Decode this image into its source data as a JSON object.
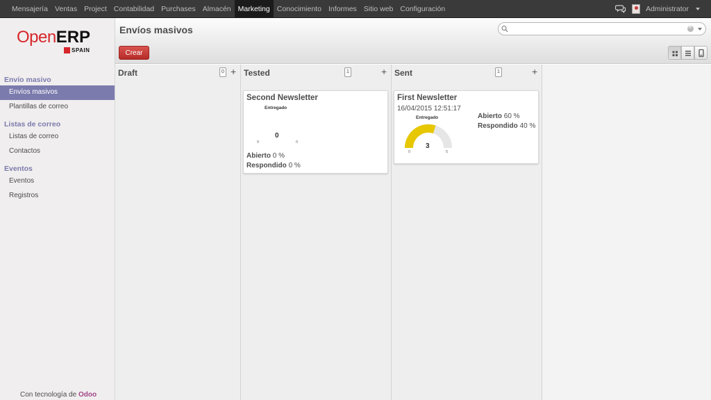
{
  "topmenu": {
    "items": [
      "Mensajería",
      "Ventas",
      "Project",
      "Contabilidad",
      "Purchases",
      "Almacén",
      "Marketing",
      "Conocimiento",
      "Informes",
      "Sitio web",
      "Configuración"
    ],
    "active": "Marketing",
    "user": "Administrator"
  },
  "logo": {
    "open": "Open",
    "erp": "ERP",
    "sub": "SPAIN",
    "brand_color": "#d7262b"
  },
  "sidebar": {
    "sections": [
      {
        "title": "Envío masivo",
        "items": [
          {
            "label": "Envíos masivos",
            "active": true
          },
          {
            "label": "Plantillas de correo"
          }
        ]
      },
      {
        "title": "Listas de correo",
        "items": [
          {
            "label": "Listas de correo"
          },
          {
            "label": "Contactos"
          }
        ]
      },
      {
        "title": "Eventos",
        "items": [
          {
            "label": "Eventos"
          },
          {
            "label": "Registros"
          }
        ]
      }
    ],
    "powered_prefix": "Con tecnología de",
    "powered_brand": "Odoo"
  },
  "header": {
    "title": "Envíos masivos",
    "create_label": "Crear",
    "search_placeholder": ""
  },
  "kanban": {
    "columns": [
      {
        "title": "Draft",
        "count": "0",
        "add": "+"
      },
      {
        "title": "Tested",
        "count": "1",
        "add": "+"
      },
      {
        "title": "Sent",
        "count": "1",
        "add": "+"
      }
    ],
    "cards": [
      {
        "title": "Second Newsletter",
        "date": "",
        "gauge_label": "Entregado",
        "gauge_value": "0",
        "gauge_fraction": 0,
        "gauge_min": "0",
        "gauge_max": "0",
        "opened_label": "Abierto",
        "opened_value": "0 %",
        "replied_label": "Respondido",
        "replied_value": "0 %"
      },
      {
        "title": "First Newsletter",
        "date": "16/04/2015 12:51:17",
        "gauge_label": "Entregado",
        "gauge_value": "3",
        "gauge_fraction": 0.6,
        "gauge_min": "0",
        "gauge_max": "5",
        "opened_label": "Abierto",
        "opened_value": "60 %",
        "replied_label": "Respondido",
        "replied_value": "40 %"
      }
    ]
  },
  "colors": {
    "accent": "#7c7bad",
    "gauge": "#e6c700",
    "gauge_track": "#e6e6e6",
    "create_button": "#c9302c"
  }
}
